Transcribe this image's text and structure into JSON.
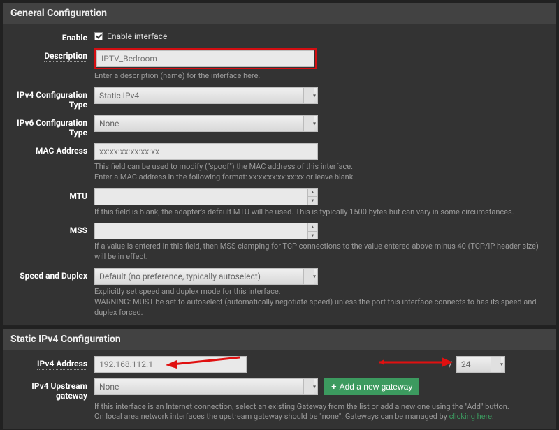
{
  "general": {
    "title": "General Configuration",
    "enable": {
      "label": "Enable",
      "checkbox_label": "Enable interface"
    },
    "description": {
      "label": "Description",
      "value": "IPTV_Bedroom",
      "help": "Enter a description (name) for the interface here."
    },
    "ipv4type": {
      "label": "IPv4 Configuration Type",
      "value": "Static IPv4"
    },
    "ipv6type": {
      "label": "IPv6 Configuration Type",
      "value": "None"
    },
    "mac": {
      "label": "MAC Address",
      "placeholder": "xx:xx:xx:xx:xx:xx",
      "help1": "This field can be used to modify (\"spoof\") the MAC address of this interface.",
      "help2": "Enter a MAC address in the following format: xx:xx:xx:xx:xx:xx or leave blank."
    },
    "mtu": {
      "label": "MTU",
      "help": "If this field is blank, the adapter's default MTU will be used. This is typically 1500 bytes but can vary in some circumstances."
    },
    "mss": {
      "label": "MSS",
      "help": "If a value is entered in this field, then MSS clamping for TCP connections to the value entered above minus 40 (TCP/IP header size) will be in effect."
    },
    "speed": {
      "label": "Speed and Duplex",
      "value": "Default (no preference, typically autoselect)",
      "help1": "Explicitly set speed and duplex mode for this interface.",
      "help2": "WARNING: MUST be set to autoselect (automatically negotiate speed) unless the port this interface connects to has its speed and duplex forced."
    }
  },
  "staticv4": {
    "title": "Static IPv4 Configuration",
    "address": {
      "label": "IPv4 Address",
      "value": "192.168.112.1",
      "cidr": "24",
      "slash": "/"
    },
    "gateway": {
      "label": "IPv4 Upstream gateway",
      "value": "None",
      "add_button": "Add a new gateway",
      "help1": "If this interface is an Internet connection, select an existing Gateway from the list or add a new one using the \"Add\" button.",
      "help2a": "On local area network interfaces the upstream gateway should be \"none\". Gateways can be managed by ",
      "help2link": "clicking here",
      "help2b": "."
    }
  }
}
